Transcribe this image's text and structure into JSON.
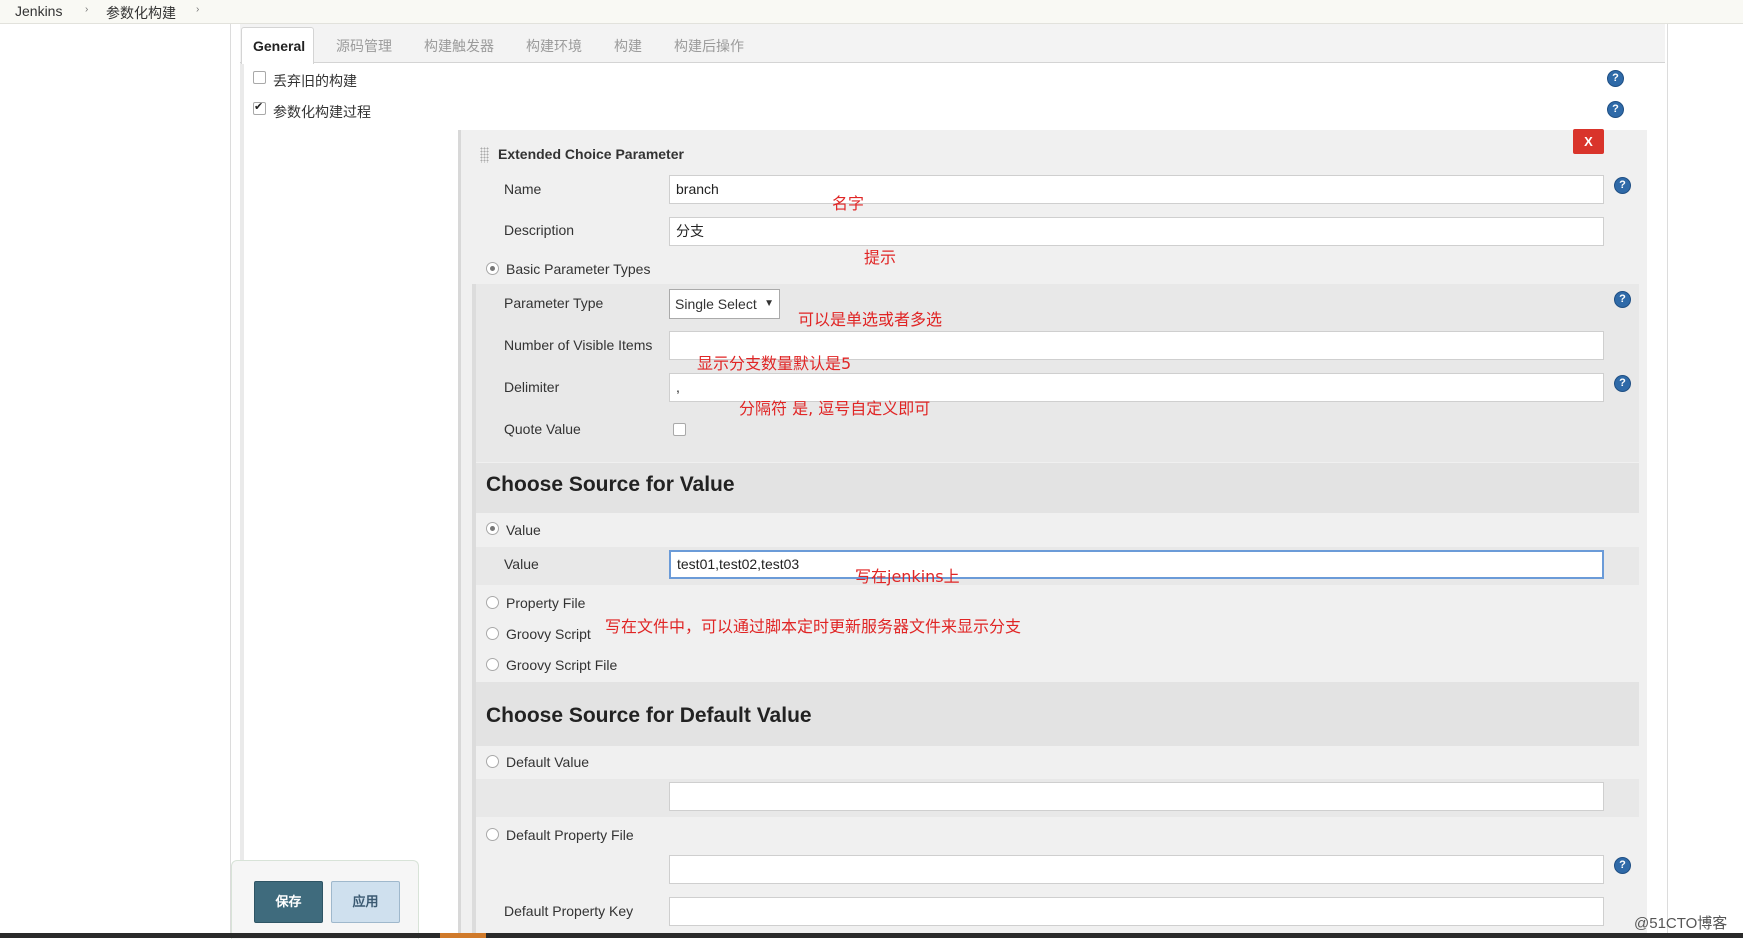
{
  "breadcrumb": {
    "items": [
      "Jenkins",
      "参数化构建"
    ],
    "separator": "›"
  },
  "tabs": [
    "General",
    "源码管理",
    "构建触发器",
    "构建环境",
    "构建",
    "构建后操作"
  ],
  "general": {
    "discard_old_builds": {
      "label": "丢弃旧的构建",
      "checked": false
    },
    "parameterized": {
      "label": "参数化构建过程",
      "checked": true
    }
  },
  "param": {
    "title": "Extended Choice Parameter",
    "delete_label": "X",
    "name_label": "Name",
    "name_value": "branch",
    "description_label": "Description",
    "description_value": "分支",
    "basic_types_label": "Basic Parameter Types",
    "parameter_type_label": "Parameter Type",
    "parameter_type_value": "Single Select",
    "visible_items_label": "Number of Visible Items",
    "visible_items_value": "",
    "delimiter_label": "Delimiter",
    "delimiter_value": ",",
    "quote_value_label": "Quote Value",
    "quote_value_checked": false
  },
  "source_value": {
    "heading": "Choose Source for Value",
    "value_radio_label": "Value",
    "value_field_label": "Value",
    "value_field_value": "test01,test02,test03",
    "property_file_label": "Property File",
    "groovy_script_label": "Groovy Script",
    "groovy_script_file_label": "Groovy Script File"
  },
  "source_default": {
    "heading": "Choose Source for Default Value",
    "default_value_label": "Default Value",
    "default_value": "",
    "default_property_file_label": "Default Property File",
    "default_property_file_value": "",
    "default_property_key_label": "Default Property Key",
    "default_property_key_value": ""
  },
  "annotations": {
    "name": "名字",
    "description": "提示",
    "parameter_type": "可以是单选或者多选",
    "visible_items": "显示分支数量默认是5",
    "delimiter": "分隔符 是, 逗号自定义即可",
    "value": "写在jenkins上",
    "property_file": "写在文件中，可以通过脚本定时更新服务器文件来显示分支"
  },
  "buttons": {
    "save": "保存",
    "apply": "应用"
  },
  "help_glyph": "?",
  "watermark": "@51CTO博客",
  "colors": {
    "annotation": "#e02525",
    "help": "#2f6aa8",
    "delete": "#d9342b",
    "save": "#3f6b7d",
    "apply": "#cfe0ee"
  }
}
